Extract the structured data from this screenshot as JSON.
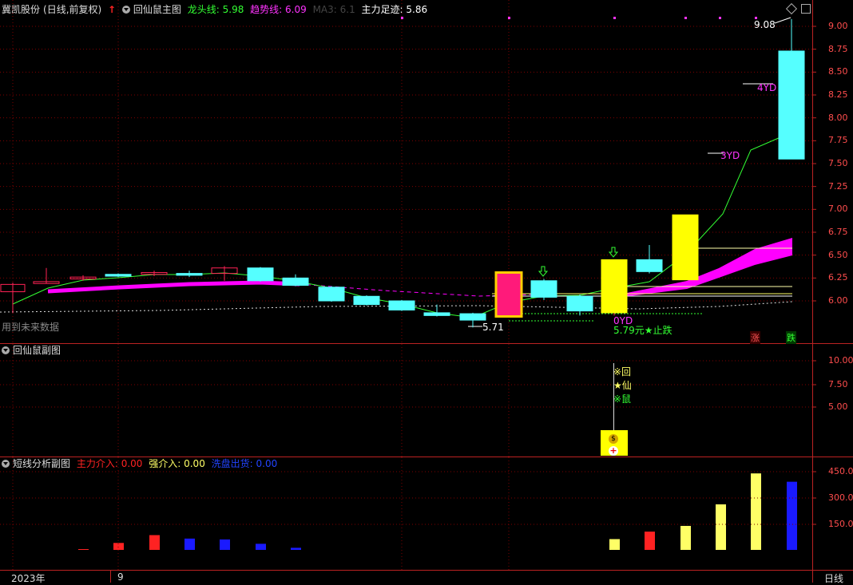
{
  "colors": {
    "up": "#ff2255",
    "down": "#55ffff",
    "axis": "#b22222",
    "ma_long": "#ff00ff",
    "ma_short": "#33ff33",
    "ma3": "#ffff66",
    "grid": "#800000"
  },
  "main_panel": {
    "stock_name": "冀凯股份",
    "period_label": "(日线,前复权)",
    "indicator_name": "回仙鼠主图",
    "up_arrow_icon": "up-arrow",
    "dragon_line": "龙头线: 5.98",
    "trend_line": "趋势线: 6.09",
    "ma3": "MA3: 6.1",
    "main_footprint": "主力足迹: 5.86",
    "y_ticks": [
      "9.00",
      "8.75",
      "8.50",
      "8.25",
      "8.00",
      "7.75",
      "7.50",
      "7.25",
      "7.00",
      "6.75",
      "6.50",
      "6.25",
      "6.00"
    ],
    "high_label": "9.08",
    "low_label": "5.71",
    "future_data_note": "用到未来数据",
    "label_0yd": "0YD",
    "label_3yd": "3YD",
    "label_4yd": "4YD",
    "stop_loss": "5.79元★止跌",
    "rise_badge": "涨",
    "fall_badge": "跌"
  },
  "sub_panel_1": {
    "title": "回仙鼠副图",
    "y_ticks": [
      "10.00",
      "7.50",
      "5.00"
    ],
    "tag_hui": "※回",
    "tag_xian": "★仙",
    "tag_shu": "※鼠",
    "money_icon": "money-bag"
  },
  "sub_panel_2": {
    "title": "短线分析副图",
    "main_intervene": "主力介入: 0.00",
    "strong_intervene": "强介入: 0.00",
    "wash_exit": "洗盘出货: 0.00",
    "y_ticks": [
      "450.0",
      "300.0",
      "150.0"
    ]
  },
  "bottom_axis": {
    "year": "2023年",
    "month": "9",
    "period": "日线"
  },
  "chart_data": [
    {
      "type": "candlestick",
      "title": "回仙鼠主图",
      "ylim": [
        5.7,
        9.12
      ],
      "y_ticks": [
        6.0,
        6.25,
        6.5,
        6.75,
        7.0,
        7.25,
        7.5,
        7.75,
        8.0,
        8.25,
        8.5,
        8.75,
        9.0
      ],
      "candles": [
        {
          "o": 6.1,
          "c": 6.18,
          "h": 6.2,
          "l": 5.87,
          "type": "up"
        },
        {
          "o": 6.19,
          "c": 6.21,
          "h": 6.36,
          "l": 6.19,
          "type": "up"
        },
        {
          "o": 6.24,
          "c": 6.26,
          "h": 6.28,
          "l": 6.22,
          "type": "up"
        },
        {
          "o": 6.29,
          "c": 6.27,
          "h": 6.3,
          "l": 6.26,
          "type": "down"
        },
        {
          "o": 6.29,
          "c": 6.31,
          "h": 6.33,
          "l": 6.27,
          "type": "up"
        },
        {
          "o": 6.3,
          "c": 6.28,
          "h": 6.33,
          "l": 6.26,
          "type": "down"
        },
        {
          "o": 6.3,
          "c": 6.36,
          "h": 6.38,
          "l": 6.22,
          "type": "up"
        },
        {
          "o": 6.36,
          "c": 6.22,
          "h": 6.37,
          "l": 6.21,
          "type": "down"
        },
        {
          "o": 6.25,
          "c": 6.17,
          "h": 6.29,
          "l": 6.16,
          "type": "down"
        },
        {
          "o": 6.15,
          "c": 6.0,
          "h": 6.16,
          "l": 5.99,
          "type": "down"
        },
        {
          "o": 6.05,
          "c": 5.96,
          "h": 6.06,
          "l": 5.95,
          "type": "down"
        },
        {
          "o": 6.0,
          "c": 5.9,
          "h": 6.01,
          "l": 5.89,
          "type": "down"
        },
        {
          "o": 5.87,
          "c": 5.84,
          "h": 5.96,
          "l": 5.83,
          "type": "down"
        },
        {
          "o": 5.86,
          "c": 5.79,
          "h": 5.87,
          "l": 5.71,
          "type": "down"
        },
        {
          "o": 5.83,
          "c": 6.31,
          "h": 6.31,
          "l": 5.83,
          "type": "up"
        },
        {
          "o": 6.22,
          "c": 6.04,
          "h": 6.24,
          "l": 6.01,
          "type": "down"
        },
        {
          "o": 6.05,
          "c": 5.89,
          "h": 6.07,
          "l": 5.84,
          "type": "down"
        },
        {
          "o": 5.87,
          "c": 6.45,
          "h": 6.45,
          "l": 5.84,
          "type": "up"
        },
        {
          "o": 6.45,
          "c": 6.32,
          "h": 6.61,
          "l": 6.3,
          "type": "down"
        },
        {
          "o": 6.23,
          "c": 6.94,
          "h": 6.94,
          "l": 6.23,
          "type": "up"
        },
        {
          "o": 8.73,
          "c": 7.55,
          "h": 9.08,
          "l": 7.55,
          "type": "down"
        }
      ]
    },
    {
      "type": "bar",
      "title": "短线分析副图",
      "ylim": [
        0,
        480
      ],
      "series": [
        {
          "name": "主力介入",
          "values": [
            3,
            28,
            55,
            0,
            0,
            0,
            0,
            0,
            0,
            0,
            0,
            0,
            0,
            0,
            0,
            0,
            0,
            0,
            72,
            0,
            0
          ]
        },
        {
          "name": "强介入",
          "values": [
            0,
            0,
            0,
            0,
            0,
            0,
            0,
            0,
            0,
            0,
            0,
            0,
            0,
            0,
            0,
            0,
            0,
            45,
            0,
            0,
            0
          ]
        },
        {
          "name": "洗盘出货",
          "values": [
            0,
            0,
            0,
            45,
            38,
            24,
            10,
            0,
            0,
            0,
            0,
            0,
            0,
            0,
            0,
            0,
            0,
            0,
            0,
            0,
            0
          ]
        }
      ],
      "yellow_bars": [
        0,
        0,
        0,
        0,
        0,
        0,
        0,
        0,
        0,
        0,
        0,
        0,
        0,
        0,
        0,
        0,
        0,
        45,
        0,
        98,
        188,
        270,
        0
      ],
      "extra_bars": [
        {
          "index": 19,
          "value": 98,
          "color": "yellow"
        },
        {
          "index": 20,
          "value": 188,
          "color": "yellow"
        },
        {
          "index": 21,
          "value": 270,
          "color": "yellow"
        },
        {
          "index": 22,
          "value": 390,
          "color": "blue"
        }
      ]
    }
  ]
}
